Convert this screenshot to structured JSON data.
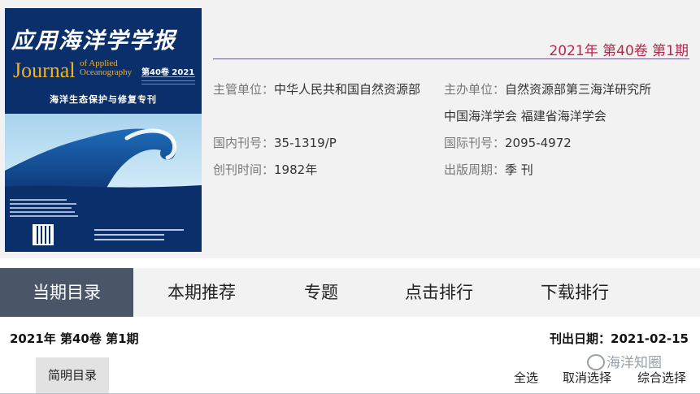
{
  "cover": {
    "title_cn": "应用海洋学学报",
    "title_en": "Journal",
    "title_en_small_1": "of Applied",
    "title_en_small_2": "Oceanography",
    "vol_label": "第40卷 2021",
    "subtitle": "海洋生态保护与修复专刊"
  },
  "issue": {
    "heading": "2021年 第40卷 第1期"
  },
  "info": {
    "supervisor_label": "主管单位：",
    "supervisor_value": "中华人民共和国自然资源部",
    "sponsor_label": "主办单位：",
    "sponsor_value_1": "自然资源部第三海洋研究所",
    "sponsor_value_2": "中国海洋学会 福建省海洋学会",
    "cn_issn_label": "国内刊号：",
    "cn_issn_value": "35-1319/P",
    "intl_issn_label": "国际刊号：",
    "intl_issn_value": "2095-4972",
    "founded_label": "创刊时间：",
    "founded_value": "1982年",
    "period_label": "出版周期：",
    "period_value": "季 刊"
  },
  "tabs": [
    {
      "label": "当期目录",
      "active": true
    },
    {
      "label": "本期推荐",
      "active": false
    },
    {
      "label": "专题",
      "active": false
    },
    {
      "label": "点击排行",
      "active": false
    },
    {
      "label": "下载排行",
      "active": false
    }
  ],
  "listing": {
    "issue_label": "2021年 第40卷 第1期",
    "publish_date": "刊出日期：2021-02-15",
    "simple_toc_button": "简明目录",
    "select_all": "全选",
    "cancel_select": "取消选择",
    "combined_select": "综合选择"
  },
  "watermark": {
    "text": "海洋知圈"
  },
  "colors": {
    "accent_red": "#b4284c",
    "tab_active_bg": "#4a5568",
    "cover_bg": "#0b2f6b",
    "cover_title_en": "#f2b21c"
  }
}
